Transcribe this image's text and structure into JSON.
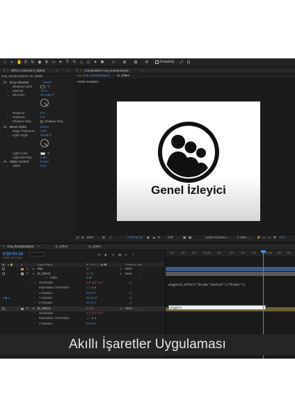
{
  "toolbar": {
    "snapping_label": "Snapping"
  },
  "effect_controls": {
    "panel_title": "Effect Controls E_Etiket",
    "breadcrumb": "Ana_Kompozisyon • E_Etiket",
    "effects": [
      {
        "name": "Drop Shadow",
        "reset": "Reset"
      },
      {
        "name": "Bevel Alpha",
        "reset": "Reset"
      },
      {
        "name": "Slider Control",
        "reset": "Reset"
      }
    ],
    "rows": {
      "shadow_color": "Shadow Color",
      "opacity": "Opacity",
      "opacity_val": "70 %",
      "direction": "Direction",
      "direction_val": "0x+135.0°",
      "distance": "Distance",
      "distance_val": "5.0",
      "softness": "Softness",
      "softness_val": "0.0",
      "shadow_only": "Shadow Only",
      "shadow_only_check": "Shadow Only",
      "edge_thickness": "Edge Thickness",
      "edge_thickness_val": "3.00",
      "light_angle": "Light Angle",
      "light_angle_val": "0x-60.0°",
      "light_color": "Light Color",
      "light_intensity": "Light Intensity",
      "light_intensity_val": "0.20",
      "slider": "Slider",
      "slider_val": "0.00"
    }
  },
  "composition": {
    "panel_title": "Composition Ana_Kompozisyon",
    "tabs": [
      "Ana_Kompozisyon",
      "E_Etiket"
    ],
    "active_camera": "Active Camera",
    "logo_text": "Genel İzleyici"
  },
  "viewer_bar": {
    "zoom": "50%",
    "timecode": "0:00:01:15",
    "resolution": "Full",
    "camera": "Active Camera",
    "views": "1 View",
    "exposure": "+0.0"
  },
  "timeline": {
    "tabs": [
      "Ana_Kompozisyon",
      "E_Etiket",
      "E_Etiket"
    ],
    "current_time": "0:00:01:15",
    "frames": "00040 (25.00 fps)",
    "headers": {
      "layer_name": "Layer Name",
      "parent": "Parent & Link"
    },
    "layers": [
      {
        "num": "1",
        "name": "ekip",
        "parent": "None"
      },
      {
        "num": "2",
        "name": "[E_Etiket]",
        "parent": "None"
      },
      {
        "num": "3",
        "name": "[E_Etiket]",
        "parent": "None"
      }
    ],
    "props": {
      "slider": "Slider",
      "slider_val": "0.00",
      "orientation": "Orientation",
      "orientation_val": "0.0°,0.0°,0.0°",
      "expression": "Expression: Orientation",
      "x_rotation": "X Rotation",
      "x_rotation_val": "0x+0.0°",
      "y_rotation": "Y Rotation",
      "y_rotation_val": "0x+25.0°",
      "z_rotation": "Z Rotation",
      "z_rotation_val": "0x+0.0°",
      "orientation2_val": "0.0°,0.0°,0.0°"
    },
    "ruler": [
      "10f",
      "15f",
      "20f",
      "01:00f",
      "05f",
      "10f",
      "15f",
      "20f",
      "02:00f",
      "05f",
      "10f"
    ],
    "expression_line": "wiggle(2,effect(\"Slider Control\")(\"Slider\"))",
    "expression_input": "wiggle("
  },
  "caption": "Akıllı İşaretler Uygulaması"
}
